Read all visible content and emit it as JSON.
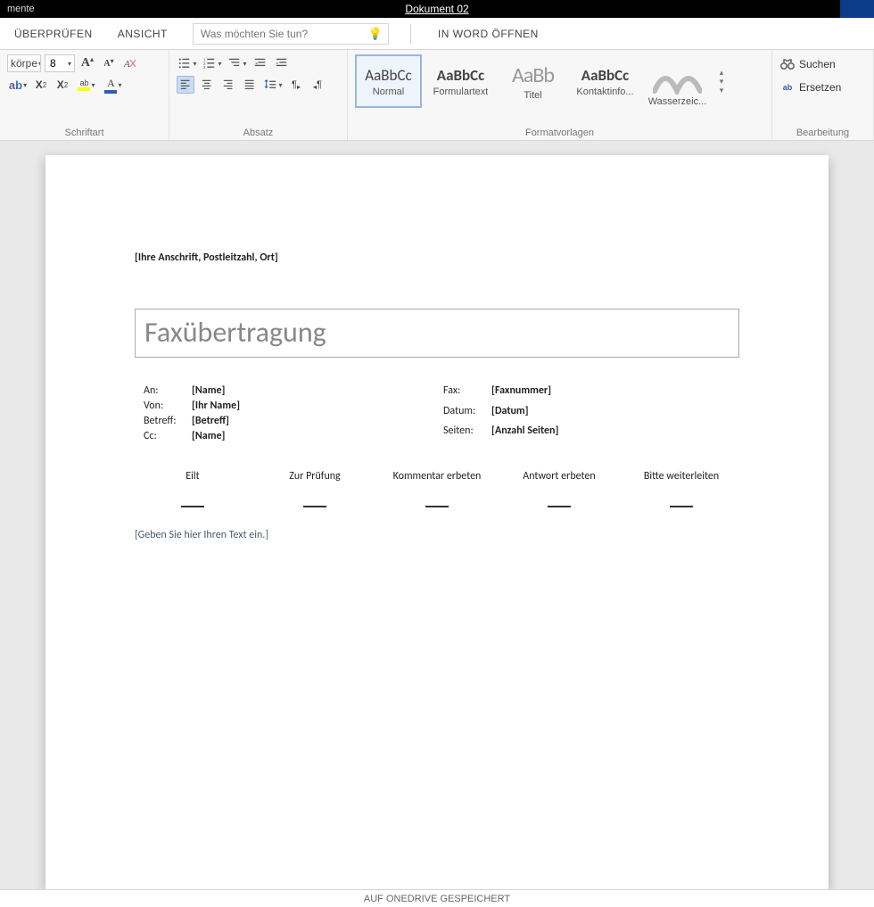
{
  "topbar": {
    "left": "mente",
    "title": "Dokument 02"
  },
  "tabs": {
    "review": "ÜBERPRÜFEN",
    "view": "ANSICHT",
    "search_placeholder": "Was möchten Sie tun?",
    "open_word": "IN WORD ÖFFNEN"
  },
  "ribbon": {
    "font": {
      "group_label": "Schriftart",
      "name_partial": "körpe",
      "size": "8"
    },
    "paragraph": {
      "group_label": "Absatz"
    },
    "styles": {
      "group_label": "Formatvorlagen",
      "items": [
        {
          "sample": "AaBbCc",
          "label": "Normal",
          "sample_style": "font-size:17px;"
        },
        {
          "sample": "AaBbCc",
          "label": "Formulartext",
          "sample_style": "font-weight:bold; font-size:17px;"
        },
        {
          "sample": "AaBb",
          "label": "Titel",
          "sample_style": "font-size:24px; color:#999; letter-spacing:-1px;"
        },
        {
          "sample": "AaBbCc",
          "label": "Kontaktinfo...",
          "sample_style": "font-weight:bold; font-size:17px;"
        },
        {
          "sample": "",
          "label": "Wasserzeic...",
          "sample_style": ""
        }
      ]
    },
    "editing": {
      "group_label": "Bearbeitung",
      "find": "Suchen",
      "replace": "Ersetzen"
    }
  },
  "document": {
    "address": "[Ihre Anschrift, Postleitzahl, Ort]",
    "title": "Faxübertragung",
    "left": {
      "an": {
        "label": "An:",
        "value": "[Name]"
      },
      "von": {
        "label": "Von:",
        "value": "[Ihr Name]"
      },
      "betreff": {
        "label": "Betreff:",
        "value": "[Betreff]"
      },
      "cc": {
        "label": "Cc:",
        "value": "[Name]"
      }
    },
    "right": {
      "fax": {
        "label": "Fax:",
        "value": "[Faxnummer]"
      },
      "datum": {
        "label": "Datum:",
        "value": "[Datum]"
      },
      "seiten": {
        "label": "Seiten:",
        "value": "[Anzahl Seiten]"
      }
    },
    "checks": [
      "Eilt",
      "Zur Prüfung",
      "Kommentar erbeten",
      "Antwort erbeten",
      "Bitte weiterleiten"
    ],
    "body": "[Geben Sie hier Ihren Text ein.]"
  },
  "statusbar": "AUF ONEDRIVE GESPEICHERT"
}
